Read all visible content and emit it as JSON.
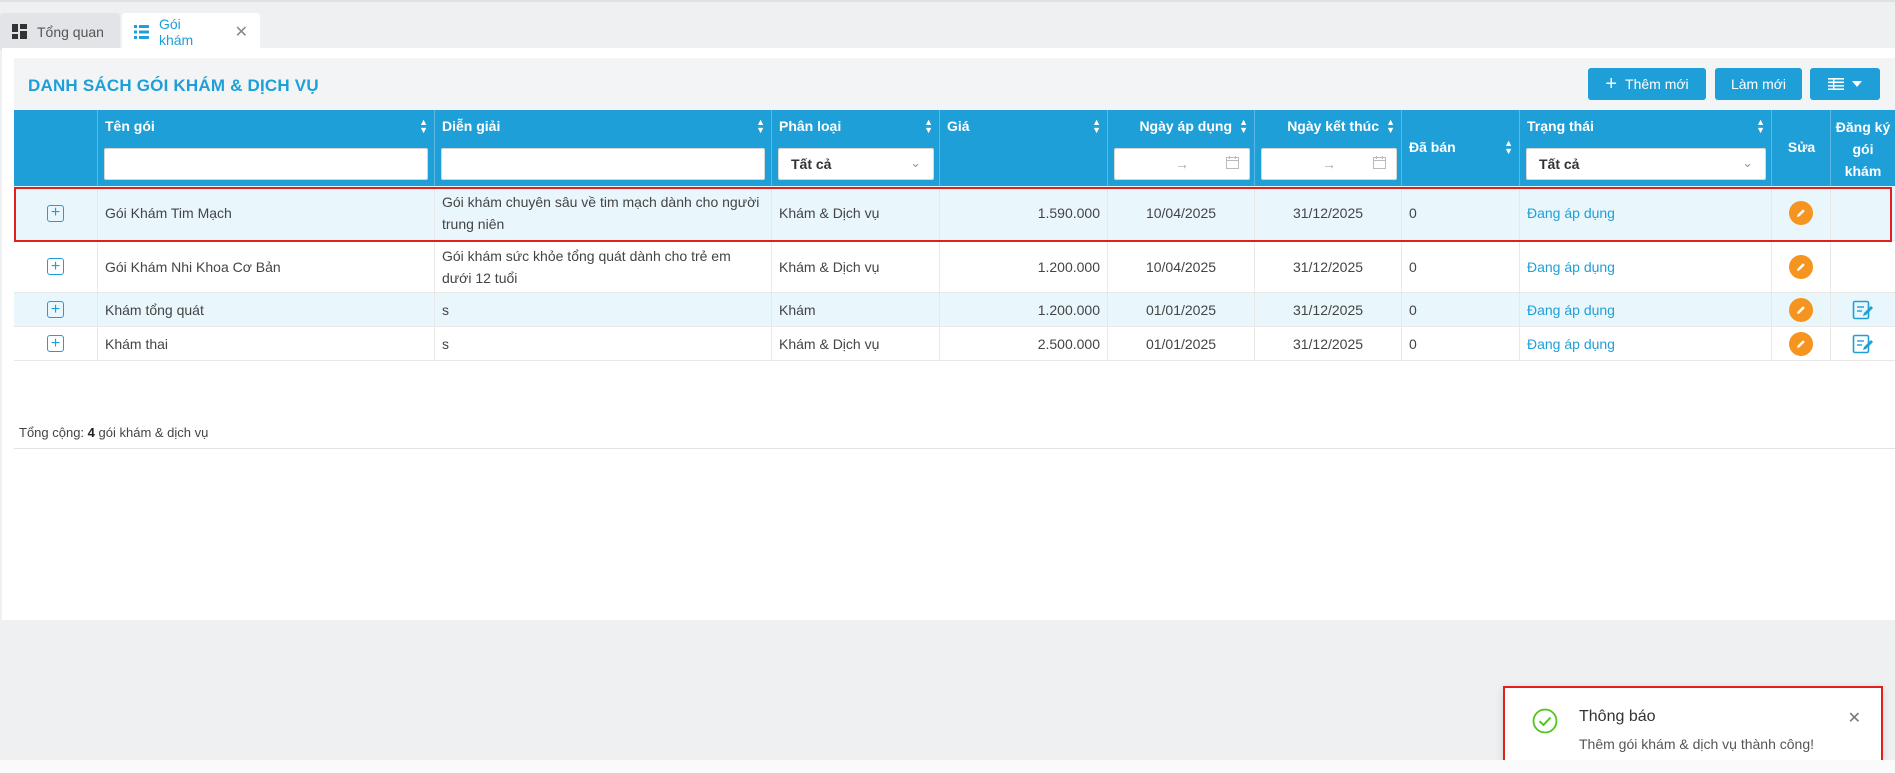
{
  "tabs": [
    {
      "label": "Tổng quan"
    },
    {
      "label": "Gói khám"
    }
  ],
  "page": {
    "title": "DANH SÁCH GÓI KHÁM & DỊCH VỤ",
    "add_label": "Thêm mới",
    "refresh_label": "Làm mới"
  },
  "columns": {
    "name": "Tên gói",
    "desc": "Diễn giải",
    "category": "Phân loại",
    "price": "Giá",
    "start": "Ngày áp dụng",
    "end": "Ngày kết thúc",
    "sold": "Đã bán",
    "status": "Trạng thái",
    "edit": "Sửa",
    "register": "Đăng ký gói khám"
  },
  "filters": {
    "category": "Tất cả",
    "status": "Tất cả",
    "date_sep": "→"
  },
  "rows": [
    {
      "name": "Gói Khám Tim Mạch",
      "desc": "Gói khám chuyên sâu về tim mạch dành cho người trung niên",
      "category": "Khám & Dịch vụ",
      "price": "1.590.000",
      "start": "10/04/2025",
      "end": "31/12/2025",
      "sold": "0",
      "status": "Đang áp dụng"
    },
    {
      "name": "Gói Khám Nhi Khoa Cơ Bản",
      "desc": "Gói khám sức khỏe tổng quát dành cho trẻ em dưới 12 tuổi",
      "category": "Khám & Dịch vụ",
      "price": "1.200.000",
      "start": "10/04/2025",
      "end": "31/12/2025",
      "sold": "0",
      "status": "Đang áp dụng"
    },
    {
      "name": "Khám tổng quát",
      "desc": "s",
      "category": "Khám",
      "price": "1.200.000",
      "start": "01/01/2025",
      "end": "31/12/2025",
      "sold": "0",
      "status": "Đang áp dụng"
    },
    {
      "name": "Khám thai",
      "desc": "s",
      "category": "Khám & Dịch vụ",
      "price": "2.500.000",
      "start": "01/01/2025",
      "end": "31/12/2025",
      "sold": "0",
      "status": "Đang áp dụng"
    }
  ],
  "footer": {
    "prefix": "Tổng cộng:",
    "count": "4",
    "suffix": "gói khám & dịch vụ"
  },
  "toast": {
    "title": "Thông báo",
    "message": "Thêm gói khám & dịch vụ thành công!"
  },
  "colors": {
    "primary": "#1e9fd8",
    "edit": "#f5941f",
    "highlight": "#e0201e",
    "success": "#52c41a"
  }
}
